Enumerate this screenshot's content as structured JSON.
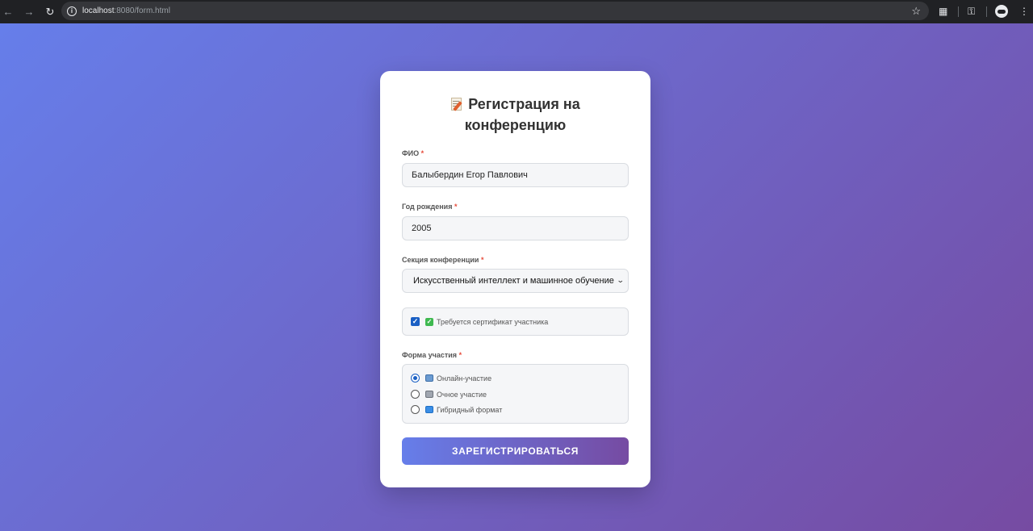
{
  "browser": {
    "url_host": "localhost",
    "url_rest": ":8080/form.html"
  },
  "form": {
    "title": "Регистрация на конференцию",
    "fio": {
      "label": "ФИО",
      "required_mark": "*",
      "value": "Балыбердин Егор Павлович"
    },
    "birth_year": {
      "label": "Год рождения",
      "required_mark": "*",
      "value": "2005"
    },
    "section": {
      "label": "Секция конференции",
      "required_mark": "*",
      "selected": "Искусственный интеллект и машинное обучение"
    },
    "certificate": {
      "checked": true,
      "label": "Требуется сертификат участника"
    },
    "participation": {
      "label": "Форма участия",
      "required_mark": "*",
      "options": [
        {
          "label": "Онлайн-участие",
          "icon": "laptop-icon",
          "selected": true
        },
        {
          "label": "Очное участие",
          "icon": "office-building-icon",
          "selected": false
        },
        {
          "label": "Гибридный формат",
          "icon": "sync-icon",
          "selected": false
        }
      ]
    },
    "submit_label": "ЗАРЕГИСТРИРОВАТЬСЯ"
  },
  "colors": {
    "gradient_start": "#667eea",
    "gradient_end": "#764ba2",
    "required": "#e74c3c",
    "accent": "#1a5fc4"
  }
}
